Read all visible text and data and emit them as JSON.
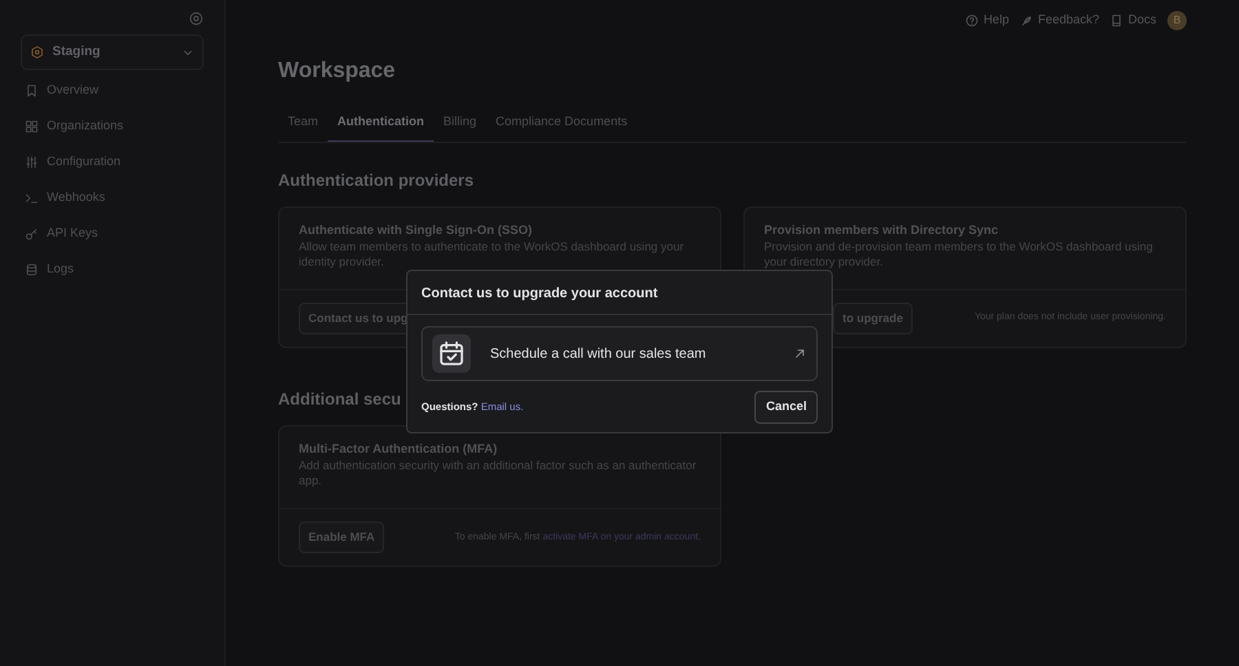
{
  "sidebar": {
    "environment": "Staging",
    "items": [
      {
        "label": "Overview"
      },
      {
        "label": "Organizations"
      },
      {
        "label": "Configuration"
      },
      {
        "label": "Webhooks"
      },
      {
        "label": "API Keys"
      },
      {
        "label": "Logs"
      }
    ]
  },
  "topbar": {
    "links": [
      {
        "label": "Help"
      },
      {
        "label": "Feedback?"
      },
      {
        "label": "Docs"
      }
    ],
    "avatar": "B"
  },
  "title": "Workspace",
  "tabs": [
    {
      "label": "Team",
      "selected": false
    },
    {
      "label": "Authentication",
      "selected": true
    },
    {
      "label": "Billing",
      "selected": false
    },
    {
      "label": "Compliance Documents",
      "selected": false
    }
  ],
  "providers": {
    "heading": "Authentication providers",
    "cards": [
      {
        "title": "Authenticate with Single Sign-On (SSO)",
        "description": "Allow team members to authenticate to the WorkOS dashboard using your identity provider.",
        "button": "Contact us to upg"
      },
      {
        "title": "Provision members with Directory Sync",
        "description": "Provision and de-provision team members to the WorkOS dashboard using your directory provider.",
        "button": "to upgrade",
        "note": "Your plan does not include user provisioning."
      }
    ]
  },
  "security": {
    "heading": "Additional secu",
    "cards": [
      {
        "title": "Multi-Factor Authentication (MFA)",
        "description": "Add authentication security with an additional factor such as an authenticator app.",
        "button": "Enable MFA",
        "note": "To enable MFA, first ",
        "note_link": "activate MFA on your admin account",
        "note_end": "."
      }
    ]
  },
  "modal": {
    "title": "Contact us to upgrade your account",
    "option": "Schedule a call with our sales team",
    "questions": "Questions?",
    "link": "Email us.",
    "cancel": "Cancel"
  }
}
